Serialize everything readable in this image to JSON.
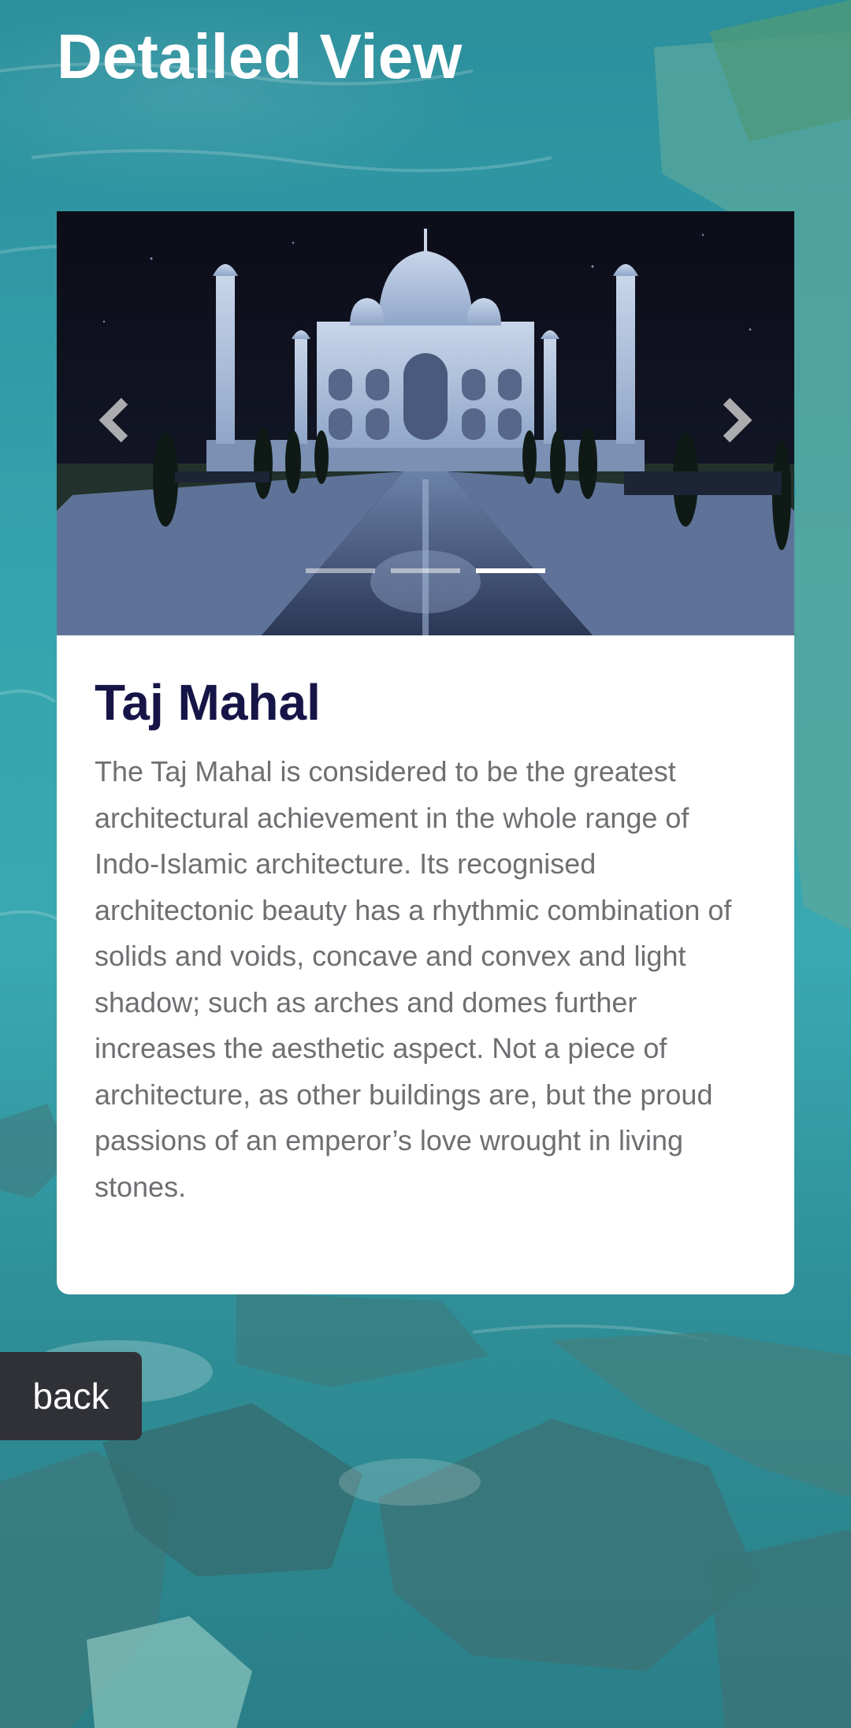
{
  "header": {
    "title": "Detailed View"
  },
  "carousel": {
    "slide_count": 3,
    "active_index": 2,
    "prev_icon": "chevron-left-icon",
    "next_icon": "chevron-right-icon"
  },
  "place": {
    "title": "Taj Mahal",
    "description": "The Taj Mahal is considered to be the greatest architectural achievement in the whole range of Indo-Islamic architecture. Its recognised architectonic beauty has a rhythmic combination of solids and voids, concave and convex and light shadow; such as arches and domes further increases the aesthetic aspect. Not a piece of architecture, as other buildings are, but the proud passions of an emperor’s love wrought in living stones."
  },
  "actions": {
    "back_label": "back"
  },
  "colors": {
    "title_text": "#171547",
    "body_text": "#6f6f73",
    "back_button_bg": "#2f3136",
    "background_sea": "#2e9aa6"
  }
}
